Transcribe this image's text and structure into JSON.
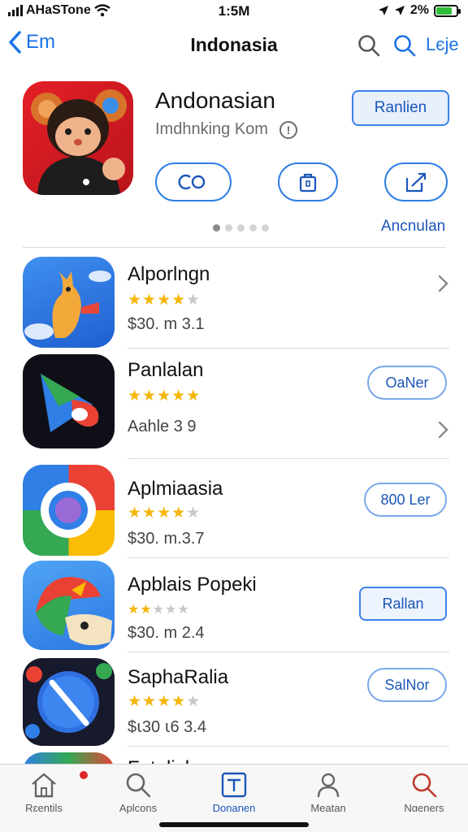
{
  "status_bar": {
    "carrier": "AНaSTone",
    "time": "1:5M",
    "battery_text": "2%"
  },
  "nav": {
    "back_label": "Em",
    "title": "Indonasia",
    "right_label": "Lєje"
  },
  "featured": {
    "title": "Andonasian",
    "subtitle": "Imdhnking Kom",
    "info_icon": "ⓘ",
    "primary_button": "Ranlien",
    "action_1": "ƐÖ",
    "action_2": "▯",
    "action_3": "▯⁄",
    "page_dots": 5,
    "active_dot": 0,
    "link": "Ancnulan"
  },
  "apps": [
    {
      "name": "Alporlngn",
      "rating": 4,
      "price": "$30. m 3.1",
      "action": null
    },
    {
      "name": "Panlalan",
      "rating": 5,
      "price": "Aahle 3 9",
      "action": "OaNer"
    },
    {
      "name": "Aplmiaasia",
      "rating": 4,
      "price": "$30. m.3.7",
      "action": "800 Ler"
    },
    {
      "name": "Apblais Popeki",
      "rating": 2,
      "price": "$30. m 2.4",
      "action": "Rallan"
    },
    {
      "name": "SaphaRalia",
      "rating": 4,
      "price": "$ꙇ30 ꙇ6 3.4",
      "action": "SalNor"
    },
    {
      "name": "Fptalisk",
      "rating": 0,
      "price": "",
      "action": null
    }
  ],
  "tabs": [
    {
      "label": "Rɛentils",
      "icon": "home-icon"
    },
    {
      "label": "Aplcons",
      "icon": "search-icon"
    },
    {
      "label": "Donanen",
      "icon": "apps-tray-icon"
    },
    {
      "label": "Meatan",
      "icon": "person-icon"
    },
    {
      "label": "Nɑeners",
      "icon": "search-red-icon"
    }
  ],
  "colors": {
    "accent": "#1a73e8",
    "star": "#f5b50a",
    "badge": "#e0262a"
  }
}
